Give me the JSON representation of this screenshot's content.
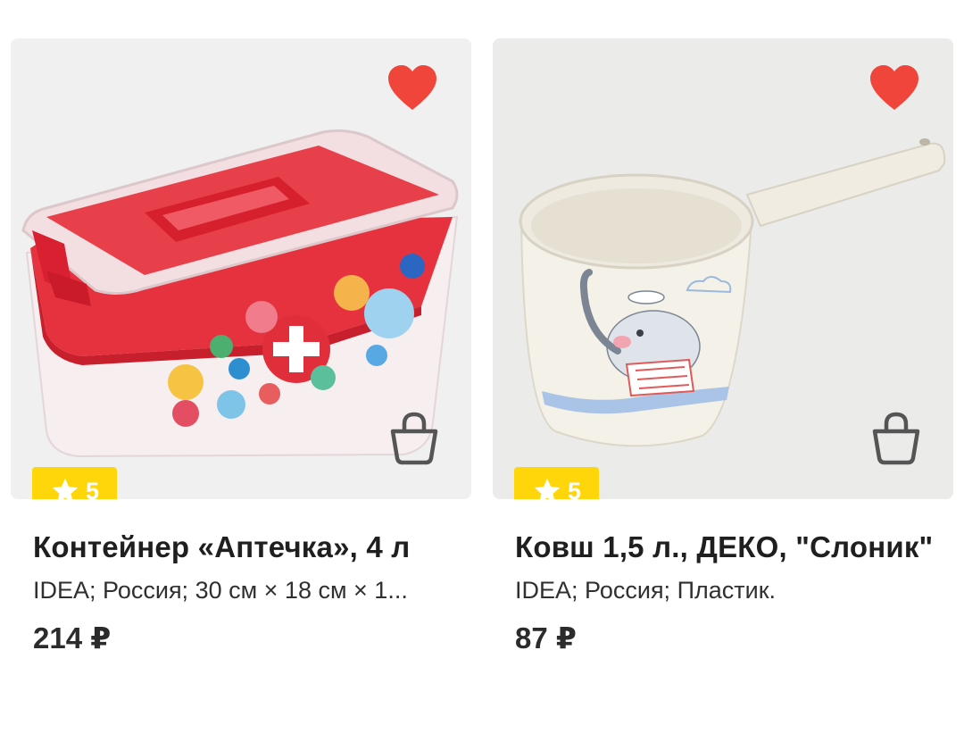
{
  "products": [
    {
      "title": "Контейнер «Аптечка», 4 л",
      "subtitle": "IDEA; Россия; 30 см × 18 см × 1...",
      "price": "214 ₽",
      "rating": "5",
      "favorite": true,
      "icons": {
        "favorite": "heart-icon",
        "cart": "shopping-bag-icon",
        "rating": "star-icon"
      }
    },
    {
      "title": "Ковш 1,5 л., ДЕКО, \"Слоник\"",
      "subtitle": "IDEA; Россия; Пластик.",
      "price": "87 ₽",
      "rating": "5",
      "favorite": true,
      "icons": {
        "favorite": "heart-icon",
        "cart": "shopping-bag-icon",
        "rating": "star-icon"
      }
    }
  ],
  "colors": {
    "heart": "#f0453b",
    "rating_badge": "#ffd60a",
    "text": "#1f1f1f",
    "cart_icon": "#555555"
  }
}
